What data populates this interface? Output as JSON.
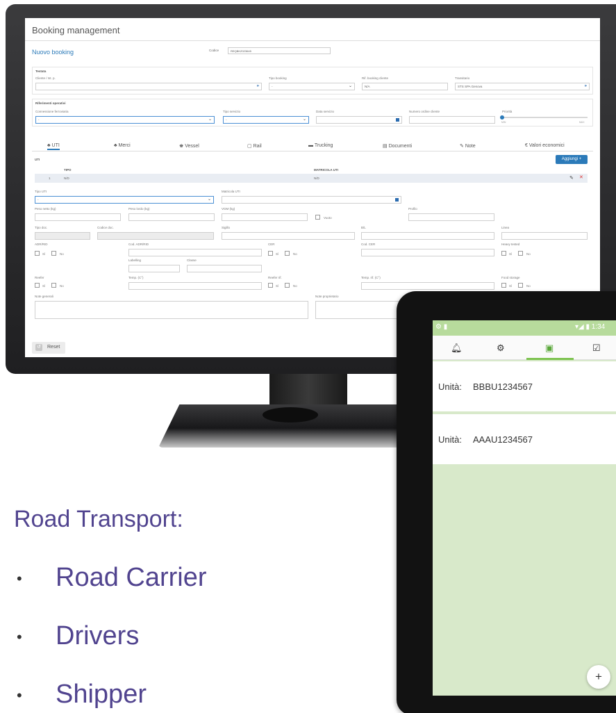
{
  "desktop": {
    "page_title": "Booking management",
    "subtitle": "Nuovo booking",
    "codice": {
      "label": "Codice",
      "value": "REQBKZ023645"
    },
    "testata": {
      "title": "Testata",
      "cliente_label": "Cliente / Ist. p.",
      "tipo_booking_label": "Tipo booking",
      "tipo_booking_value": "-",
      "rif_booking_label": "Rif. booking cliente",
      "rif_booking_value": "N/A",
      "transitario_label": "Transitario",
      "transitario_value": "STS SPA Genova"
    },
    "riferimenti": {
      "title": "Riferimenti operativi",
      "connessione_label": "Connessione ferroviaria",
      "connessione_value": "-",
      "tipo_servizio_label": "Tipo servizio",
      "tipo_servizio_value": "-",
      "data_servizio_label": "Data servizio",
      "numero_ordine_label": "Numero ordine cliente",
      "priorita_label": "Priorità",
      "priorita_min": "MIN",
      "priorita_max": "MAX"
    },
    "tabs": [
      {
        "icon": "♣",
        "label": "UTI"
      },
      {
        "icon": "♣",
        "label": "Merci"
      },
      {
        "icon": "♚",
        "label": "Vessel"
      },
      {
        "icon": "▢",
        "label": "Rail"
      },
      {
        "icon": "▬",
        "label": "Trucking"
      },
      {
        "icon": "▤",
        "label": "Documenti"
      },
      {
        "icon": "✎",
        "label": "Note"
      },
      {
        "icon": "€",
        "label": "Valori economici"
      }
    ],
    "uti": {
      "title": "UTI",
      "add_label": "Aggiungi +",
      "col_tipo": "TIPO",
      "col_matricola": "MATRICOLA UTI",
      "row_index": "1",
      "row_tipo": "N/D",
      "row_matricola": "N/D"
    },
    "form": {
      "tipo_uti_label": "Tipo UTI",
      "tipo_uti_value": "-",
      "matricola_label": "Matricola UTI",
      "peso_netto_label": "Peso netto (kg)",
      "peso_lordo_label": "Peso lordo (kg)",
      "vgm_label": "VGM (kg)",
      "vuoto_label": "Vuoto",
      "profilo_label": "Profilo",
      "tipo_doc_label": "Tipo doc.",
      "codice_doc_label": "Codice doc.",
      "sigillo_label": "Sigillo",
      "bl_label": "B/L",
      "linea_label": "Linea",
      "adr_label": "ADR/RID",
      "cod_adr_label": "Cod. ADR/RID",
      "labelling_label": "Labelling",
      "classe_label": "Classe",
      "cer_label": "CER",
      "cod_cer_label": "Cod. CER",
      "heavy_label": "Heavy tested",
      "reefer_label": "Reefer",
      "temp_label": "Temp. (C°)",
      "reefer_rif_label": "Reefer rif.",
      "temp_rif_label": "Temp. rif. (C°)",
      "food_label": "Food storage",
      "si": "Sì",
      "no": "No",
      "note_generali_label": "Note generali",
      "note_proprietario_label": "Note proprietario"
    },
    "reset_label": "Reset"
  },
  "tablet": {
    "status_left": "⚙ ▮",
    "status_right": "▾◢ ▮ 1:34",
    "tab_icons": [
      "bell-icon",
      "gear-icon",
      "box-icon",
      "checklist-icon"
    ],
    "cards": [
      {
        "label": "Unità:",
        "value": "BBBU1234567"
      },
      {
        "label": "Unità:",
        "value": "AAAU1234567"
      }
    ],
    "fab_label": "+"
  },
  "text": {
    "heading": "Road Transport:",
    "bullets": [
      "Road Carrier",
      "Drivers",
      "Shipper"
    ],
    "bullet_char": "•"
  },
  "colors": {
    "heading": "#51448f",
    "accent_blue": "#2b7ab9",
    "tablet_green": "#d8e9ca",
    "tablet_status": "#b7db9c",
    "tab_underline": "#7cc24f"
  }
}
